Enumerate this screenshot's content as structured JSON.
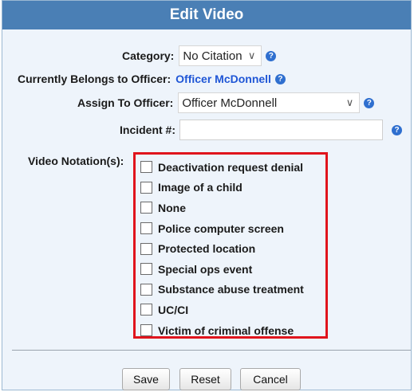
{
  "dialog": {
    "title": "Edit Video"
  },
  "category": {
    "label": "Category:",
    "value": "No Citation"
  },
  "belongs": {
    "label": "Currently Belongs to Officer:",
    "value": "Officer McDonnell"
  },
  "assign": {
    "label": "Assign To Officer:",
    "value": "Officer McDonnell"
  },
  "incident": {
    "label": "Incident #:",
    "value": ""
  },
  "notations": {
    "label": "Video Notation(s):",
    "items": [
      "Deactivation request denial",
      "Image of a child",
      "None",
      "Police computer screen",
      "Protected location",
      "Special ops event",
      "Substance abuse treatment",
      "UC/CI",
      "Victim of criminal offense"
    ]
  },
  "buttons": {
    "save": "Save",
    "reset": "Reset",
    "cancel": "Cancel"
  },
  "help_glyph": "?",
  "chevron_glyph": "∨",
  "colors": {
    "title_bar": "#4a7fb5",
    "link": "#1f56d6",
    "highlight_border": "#e0141c",
    "help_icon": "#2f6fcf"
  }
}
